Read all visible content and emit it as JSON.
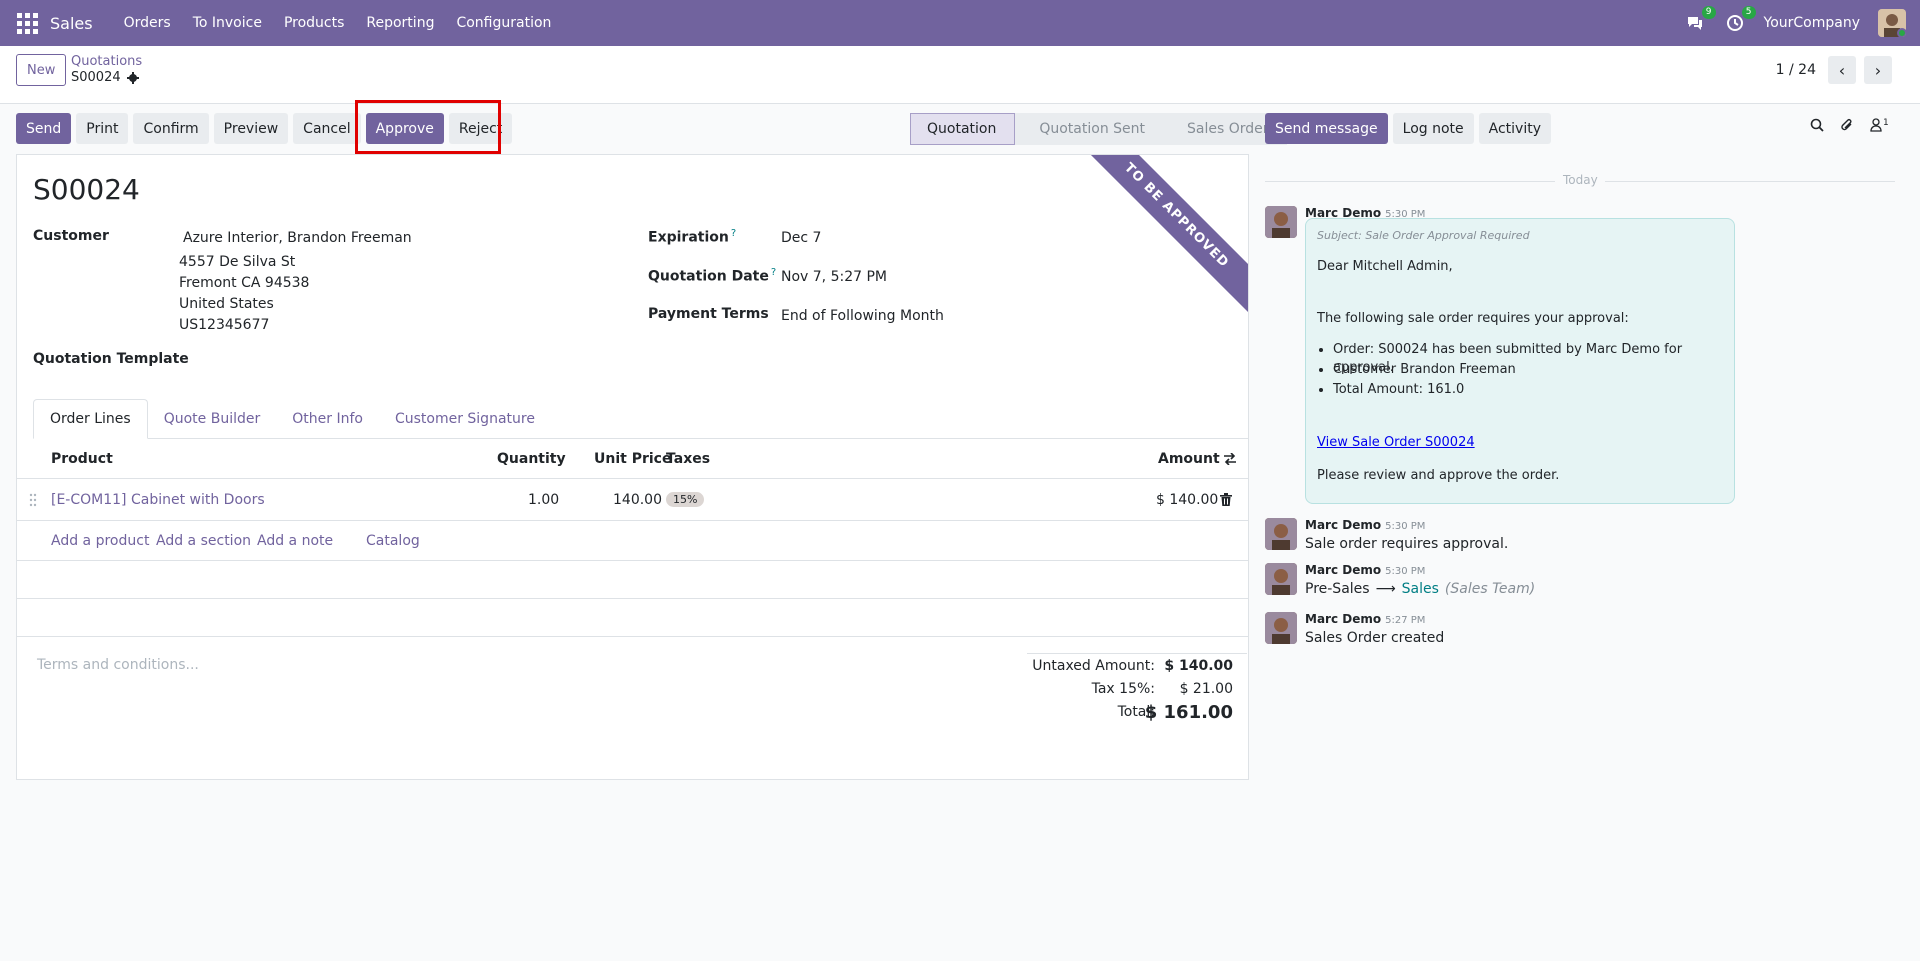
{
  "navbar": {
    "app_name": "Sales",
    "menu": [
      "Orders",
      "To Invoice",
      "Products",
      "Reporting",
      "Configuration"
    ],
    "messages_badge": "9",
    "activities_badge": "5",
    "company": "YourCompany"
  },
  "control_panel": {
    "new_label": "New",
    "breadcrumb_parent": "Quotations",
    "breadcrumb_current": "S00024",
    "pager_value": "1 / 24"
  },
  "actions": {
    "send": "Send",
    "print": "Print",
    "confirm": "Confirm",
    "preview": "Preview",
    "cancel": "Cancel",
    "approve": "Approve",
    "reject": "Reject"
  },
  "statusbar": {
    "stages": [
      "Quotation",
      "Quotation Sent",
      "Sales Order"
    ],
    "active": "Quotation"
  },
  "form": {
    "ribbon": "TO BE APPROVED",
    "name": "S00024",
    "customer_label": "Customer",
    "customer_name": "Azure Interior, Brandon Freeman",
    "customer_address": [
      "4557 De Silva St",
      "Fremont CA 94538",
      "United States",
      "US12345677"
    ],
    "expiration_label": "Expiration",
    "expiration_value": "Dec 7",
    "quotation_date_label": "Quotation Date",
    "quotation_date_value": "Nov 7, 5:27 PM",
    "payment_terms_label": "Payment Terms",
    "payment_terms_value": "End of Following Month",
    "template_label": "Quotation Template",
    "help_mark": "?"
  },
  "tabs": [
    "Order Lines",
    "Quote Builder",
    "Other Info",
    "Customer Signature"
  ],
  "table": {
    "headers": {
      "product": "Product",
      "quantity": "Quantity",
      "unit_price": "Unit Price",
      "taxes": "Taxes",
      "amount": "Amount"
    },
    "rows": [
      {
        "product": "[E-COM11] Cabinet with Doors",
        "quantity": "1.00",
        "unit_price": "140.00",
        "tax": "15%",
        "amount": "$ 140.00"
      }
    ],
    "add_product": "Add a product",
    "add_section": "Add a section",
    "add_note": "Add a note",
    "catalog": "Catalog"
  },
  "terms_placeholder": "Terms and conditions...",
  "totals": {
    "untaxed_label": "Untaxed Amount:",
    "untaxed_value": "$ 140.00",
    "tax_label": "Tax 15%:",
    "tax_value": "$ 21.00",
    "total_label": "Total:",
    "total_value": "$ 161.00"
  },
  "chatter": {
    "send_message": "Send message",
    "log_note": "Log note",
    "activity": "Activity",
    "followers_count": "1",
    "today": "Today",
    "messages": [
      {
        "author": "Marc Demo",
        "time": "5:30 PM",
        "subject": "Subject: Sale Order Approval Required",
        "greeting": "Dear Mitchell Admin,",
        "intro": "The following sale order requires your approval:",
        "bullets": [
          "Order: S00024 has been submitted by Marc Demo for approval.",
          "Customer Brandon Freeman",
          "Total Amount: 161.0"
        ],
        "link": "View Sale Order S00024",
        "closing": "Please review and approve the order."
      },
      {
        "author": "Marc Demo",
        "time": "5:30 PM",
        "body": "Sale order requires approval."
      },
      {
        "author": "Marc Demo",
        "time": "5:30 PM",
        "old_value": "Pre-Sales",
        "arrow": "⟶",
        "new_value": "Sales",
        "field": "(Sales Team)"
      },
      {
        "author": "Marc Demo",
        "time": "5:27 PM",
        "body": "Sales Order created"
      }
    ]
  },
  "colors": {
    "brand": "#71639e",
    "accent": "#017e84",
    "highlight": "#e00000"
  }
}
